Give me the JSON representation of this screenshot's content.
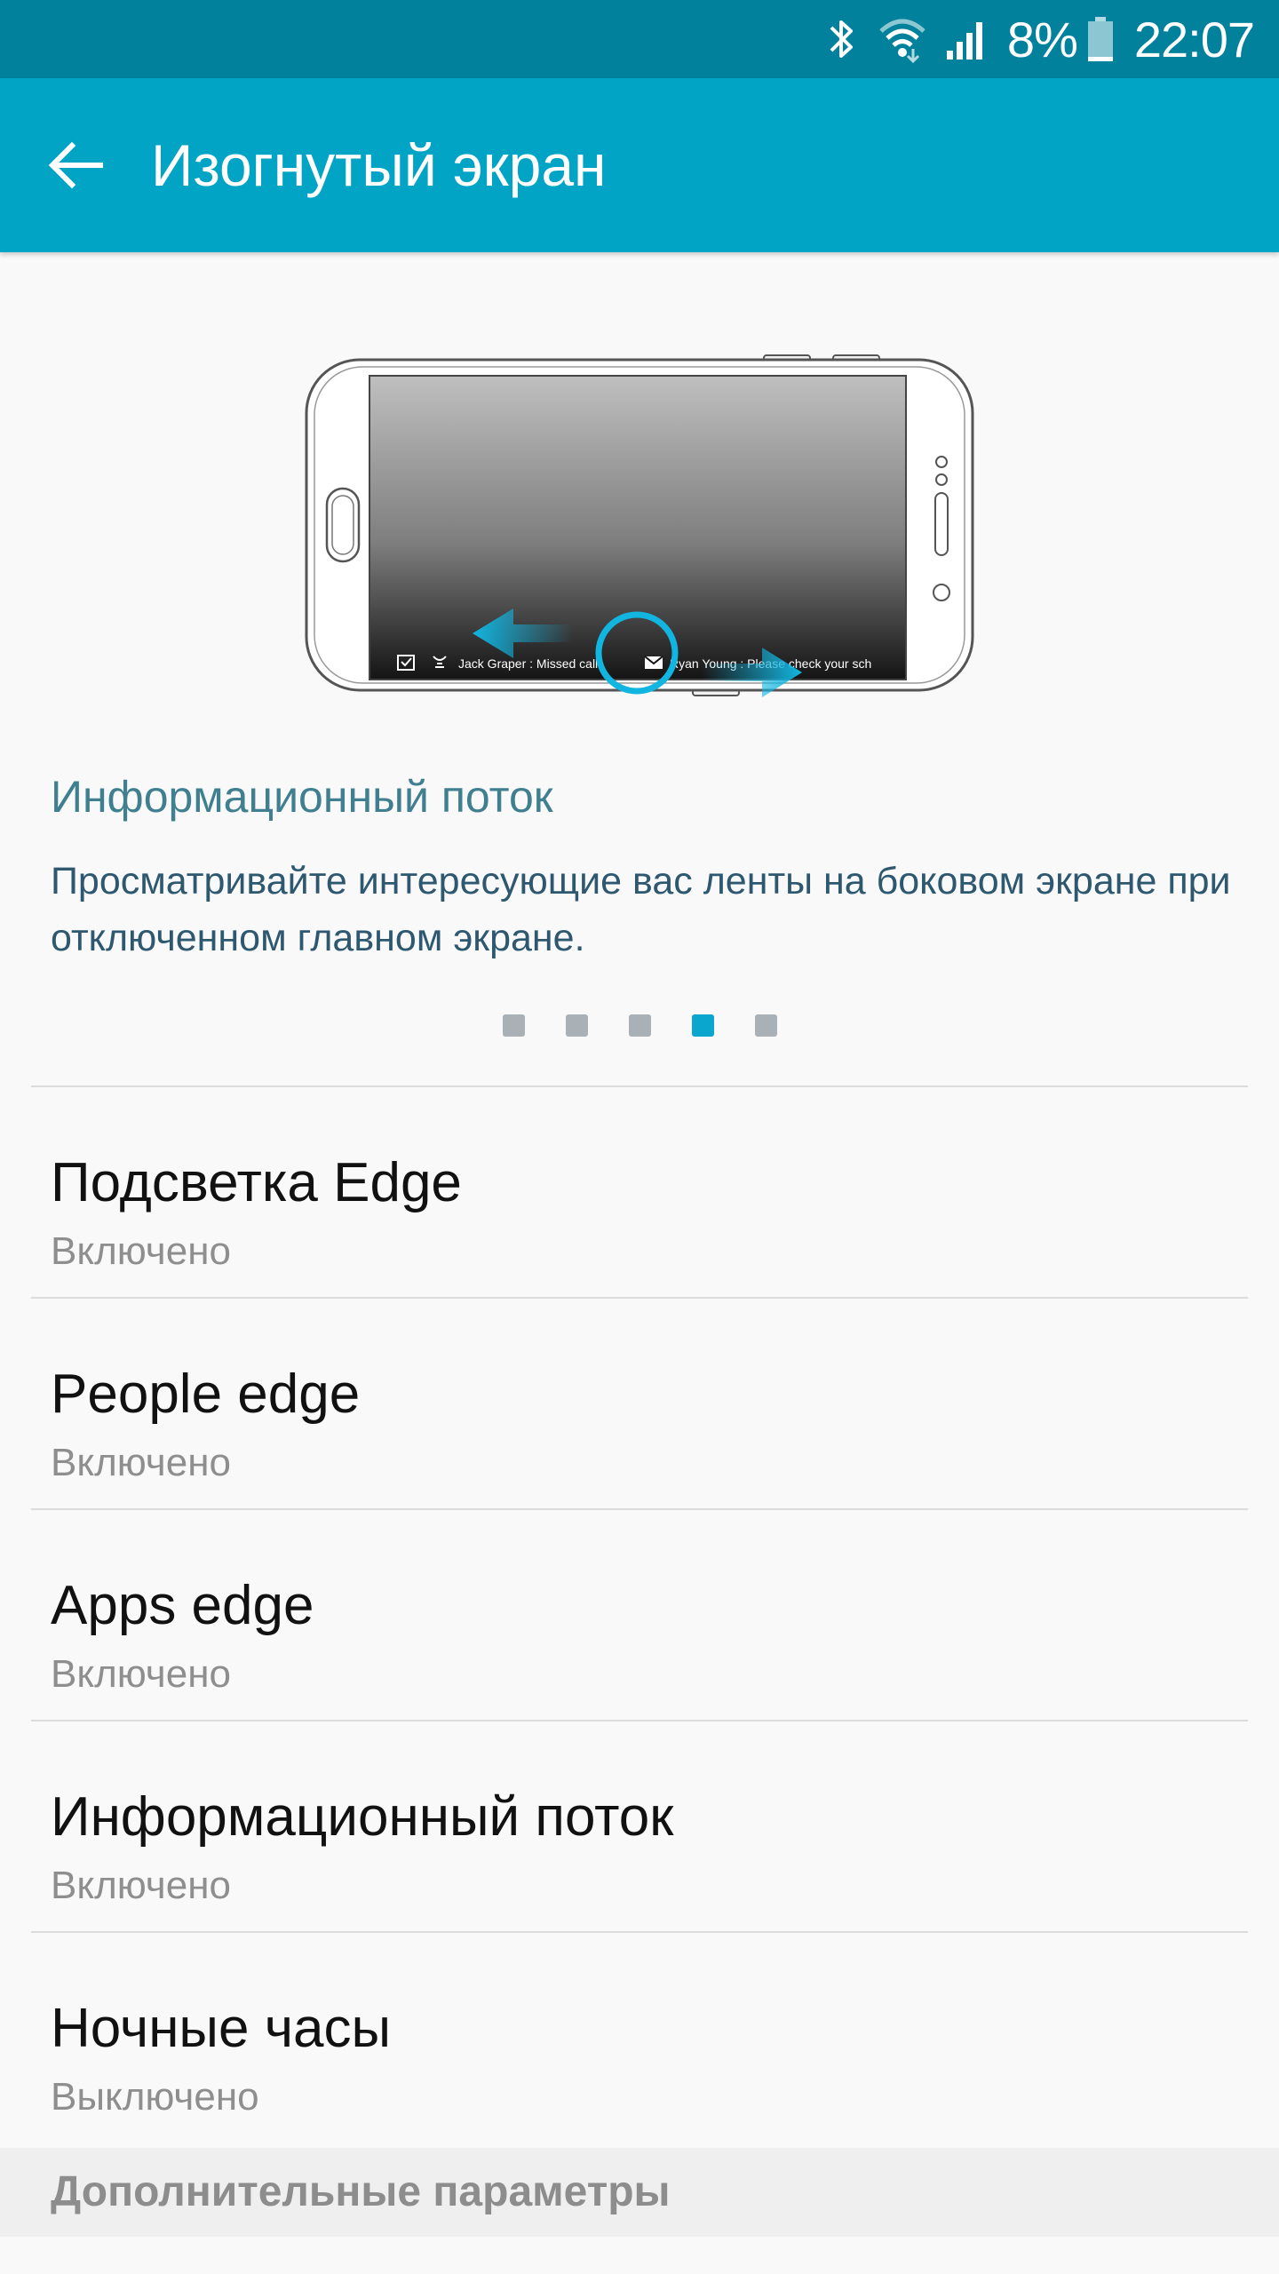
{
  "status_bar": {
    "battery_percent": "8%",
    "time": "22:07",
    "icons": [
      "bluetooth-icon",
      "wifi-icon",
      "cellular-signal-icon",
      "battery-icon"
    ]
  },
  "app_bar": {
    "title": "Изогнутый экран",
    "back_icon": "arrow-left-icon"
  },
  "illustration": {
    "notifications": [
      {
        "sender": "Jack Graper",
        "text": "Missed call"
      },
      {
        "sender": "Ryan Young",
        "text": "Please check your sch"
      }
    ]
  },
  "feature": {
    "title": "Информационный поток",
    "description": "Просматривайте интересующие вас ленты на боковом экране при отключенном главном экране.",
    "pager": {
      "total": 5,
      "active_index": 3
    }
  },
  "settings": [
    {
      "title": "Подсветка Edge",
      "state": "Включено"
    },
    {
      "title": "People edge",
      "state": "Включено"
    },
    {
      "title": "Apps edge",
      "state": "Включено"
    },
    {
      "title": "Информационный поток",
      "state": "Включено"
    },
    {
      "title": "Ночные часы",
      "state": "Выключено"
    }
  ],
  "section_header": "Дополнительные параметры",
  "colors": {
    "status_bar": "#01819c",
    "app_bar": "#02a4c6",
    "accent": "#0aa6cd",
    "feature_title": "#3f7f8f"
  }
}
